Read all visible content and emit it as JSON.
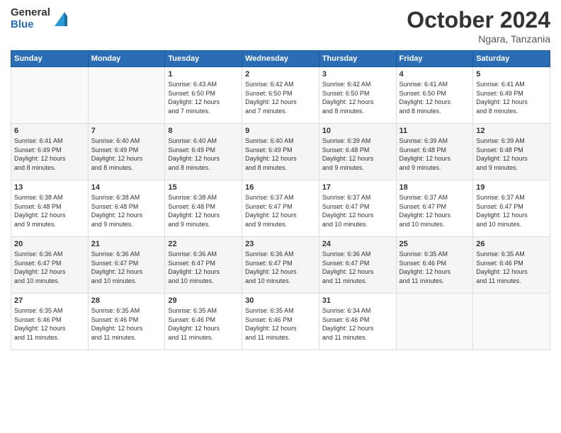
{
  "header": {
    "logo_line1": "General",
    "logo_line2": "Blue",
    "title": "October 2024",
    "subtitle": "Ngara, Tanzania"
  },
  "weekdays": [
    "Sunday",
    "Monday",
    "Tuesday",
    "Wednesday",
    "Thursday",
    "Friday",
    "Saturday"
  ],
  "weeks": [
    {
      "days": [
        {
          "num": "",
          "detail": ""
        },
        {
          "num": "",
          "detail": ""
        },
        {
          "num": "1",
          "detail": "Sunrise: 6:43 AM\nSunset: 6:50 PM\nDaylight: 12 hours\nand 7 minutes."
        },
        {
          "num": "2",
          "detail": "Sunrise: 6:42 AM\nSunset: 6:50 PM\nDaylight: 12 hours\nand 7 minutes."
        },
        {
          "num": "3",
          "detail": "Sunrise: 6:42 AM\nSunset: 6:50 PM\nDaylight: 12 hours\nand 8 minutes."
        },
        {
          "num": "4",
          "detail": "Sunrise: 6:41 AM\nSunset: 6:50 PM\nDaylight: 12 hours\nand 8 minutes."
        },
        {
          "num": "5",
          "detail": "Sunrise: 6:41 AM\nSunset: 6:49 PM\nDaylight: 12 hours\nand 8 minutes."
        }
      ]
    },
    {
      "days": [
        {
          "num": "6",
          "detail": "Sunrise: 6:41 AM\nSunset: 6:49 PM\nDaylight: 12 hours\nand 8 minutes."
        },
        {
          "num": "7",
          "detail": "Sunrise: 6:40 AM\nSunset: 6:49 PM\nDaylight: 12 hours\nand 8 minutes."
        },
        {
          "num": "8",
          "detail": "Sunrise: 6:40 AM\nSunset: 6:49 PM\nDaylight: 12 hours\nand 8 minutes."
        },
        {
          "num": "9",
          "detail": "Sunrise: 6:40 AM\nSunset: 6:49 PM\nDaylight: 12 hours\nand 8 minutes."
        },
        {
          "num": "10",
          "detail": "Sunrise: 6:39 AM\nSunset: 6:48 PM\nDaylight: 12 hours\nand 9 minutes."
        },
        {
          "num": "11",
          "detail": "Sunrise: 6:39 AM\nSunset: 6:48 PM\nDaylight: 12 hours\nand 9 minutes."
        },
        {
          "num": "12",
          "detail": "Sunrise: 6:39 AM\nSunset: 6:48 PM\nDaylight: 12 hours\nand 9 minutes."
        }
      ]
    },
    {
      "days": [
        {
          "num": "13",
          "detail": "Sunrise: 6:38 AM\nSunset: 6:48 PM\nDaylight: 12 hours\nand 9 minutes."
        },
        {
          "num": "14",
          "detail": "Sunrise: 6:38 AM\nSunset: 6:48 PM\nDaylight: 12 hours\nand 9 minutes."
        },
        {
          "num": "15",
          "detail": "Sunrise: 6:38 AM\nSunset: 6:48 PM\nDaylight: 12 hours\nand 9 minutes."
        },
        {
          "num": "16",
          "detail": "Sunrise: 6:37 AM\nSunset: 6:47 PM\nDaylight: 12 hours\nand 9 minutes."
        },
        {
          "num": "17",
          "detail": "Sunrise: 6:37 AM\nSunset: 6:47 PM\nDaylight: 12 hours\nand 10 minutes."
        },
        {
          "num": "18",
          "detail": "Sunrise: 6:37 AM\nSunset: 6:47 PM\nDaylight: 12 hours\nand 10 minutes."
        },
        {
          "num": "19",
          "detail": "Sunrise: 6:37 AM\nSunset: 6:47 PM\nDaylight: 12 hours\nand 10 minutes."
        }
      ]
    },
    {
      "days": [
        {
          "num": "20",
          "detail": "Sunrise: 6:36 AM\nSunset: 6:47 PM\nDaylight: 12 hours\nand 10 minutes."
        },
        {
          "num": "21",
          "detail": "Sunrise: 6:36 AM\nSunset: 6:47 PM\nDaylight: 12 hours\nand 10 minutes."
        },
        {
          "num": "22",
          "detail": "Sunrise: 6:36 AM\nSunset: 6:47 PM\nDaylight: 12 hours\nand 10 minutes."
        },
        {
          "num": "23",
          "detail": "Sunrise: 6:36 AM\nSunset: 6:47 PM\nDaylight: 12 hours\nand 10 minutes."
        },
        {
          "num": "24",
          "detail": "Sunrise: 6:36 AM\nSunset: 6:47 PM\nDaylight: 12 hours\nand 11 minutes."
        },
        {
          "num": "25",
          "detail": "Sunrise: 6:35 AM\nSunset: 6:46 PM\nDaylight: 12 hours\nand 11 minutes."
        },
        {
          "num": "26",
          "detail": "Sunrise: 6:35 AM\nSunset: 6:46 PM\nDaylight: 12 hours\nand 11 minutes."
        }
      ]
    },
    {
      "days": [
        {
          "num": "27",
          "detail": "Sunrise: 6:35 AM\nSunset: 6:46 PM\nDaylight: 12 hours\nand 11 minutes."
        },
        {
          "num": "28",
          "detail": "Sunrise: 6:35 AM\nSunset: 6:46 PM\nDaylight: 12 hours\nand 11 minutes."
        },
        {
          "num": "29",
          "detail": "Sunrise: 6:35 AM\nSunset: 6:46 PM\nDaylight: 12 hours\nand 11 minutes."
        },
        {
          "num": "30",
          "detail": "Sunrise: 6:35 AM\nSunset: 6:46 PM\nDaylight: 12 hours\nand 11 minutes."
        },
        {
          "num": "31",
          "detail": "Sunrise: 6:34 AM\nSunset: 6:46 PM\nDaylight: 12 hours\nand 11 minutes."
        },
        {
          "num": "",
          "detail": ""
        },
        {
          "num": "",
          "detail": ""
        }
      ]
    }
  ]
}
